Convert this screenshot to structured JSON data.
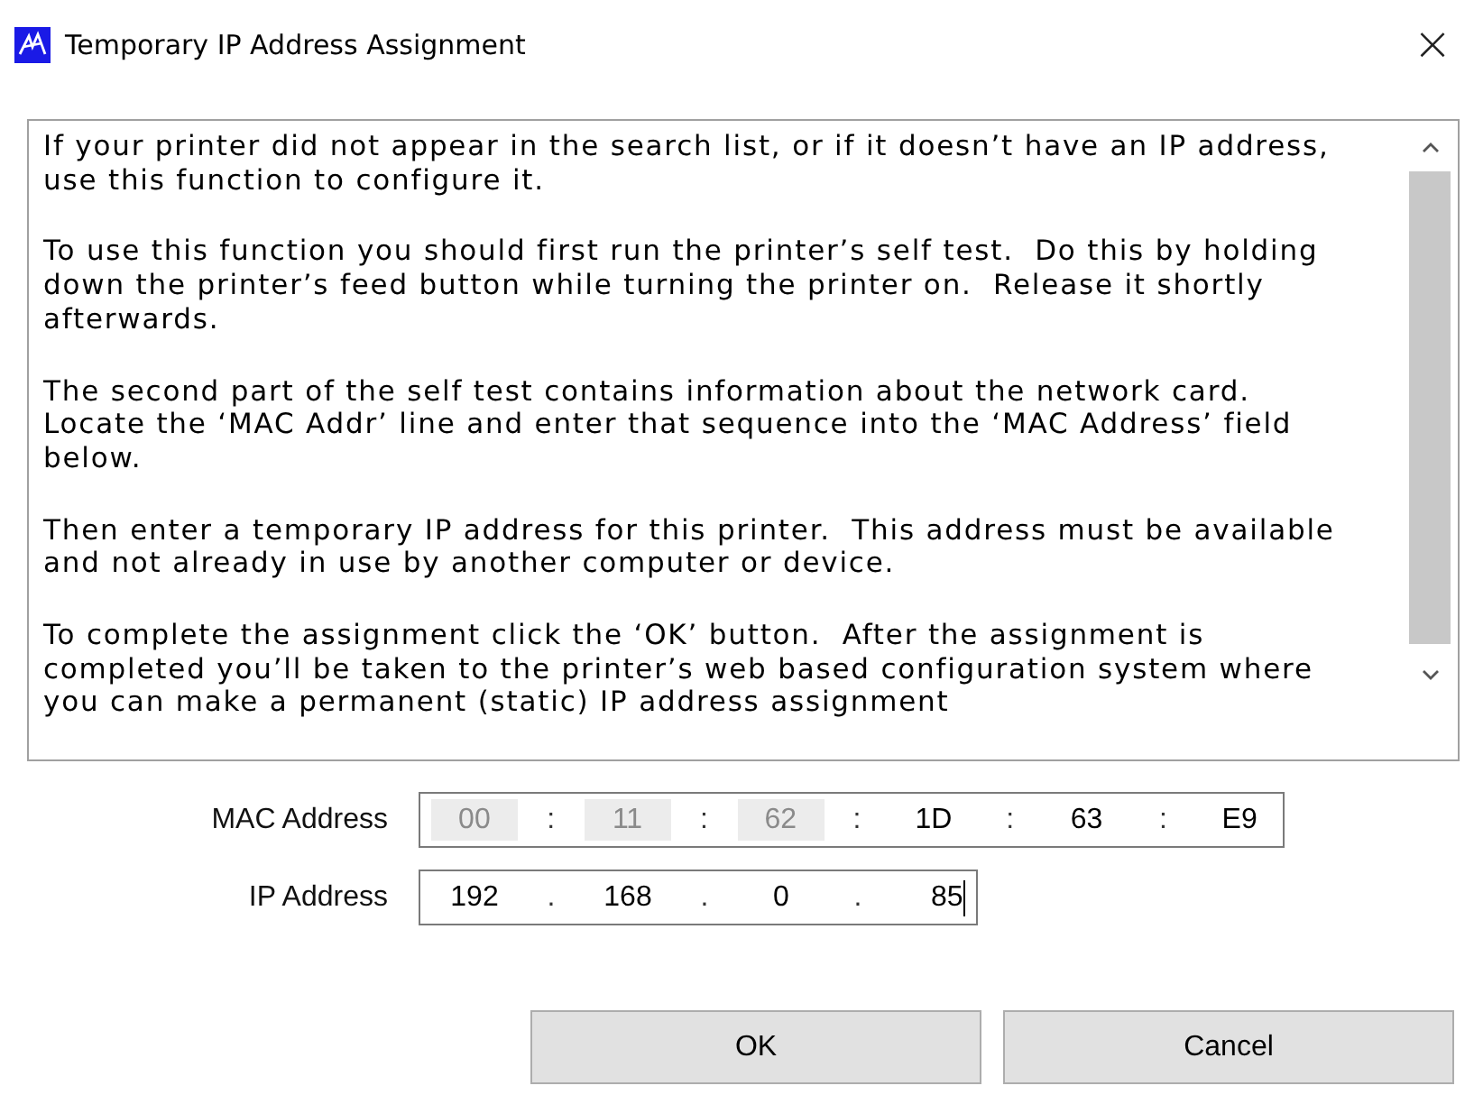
{
  "window": {
    "title": "Temporary IP Address Assignment",
    "close": "×"
  },
  "instructions": [
    [
      "If your printer did not appear in the search list, or if it doesn’t have an IP address,",
      "use this function to configure it."
    ],
    [
      "To use this function you should first run the printer’s self test.  Do this by holding",
      "down the printer’s feed button while turning the printer on.  Release it shortly",
      "afterwards."
    ],
    [
      "The second part of the self test contains information about the network card.",
      "Locate the ‘MAC Addr’ line and enter that sequence into the ‘MAC Address’ field",
      "below."
    ],
    [
      "Then enter a temporary IP address for this printer.  This address must be available",
      "and not already in use by another computer or device."
    ],
    [
      "To complete the assignment click the ‘OK’ button.  After the assignment is",
      "completed you’ll be taken to the printer’s web based configuration system where",
      "you can make a permanent (static) IP address assignment"
    ]
  ],
  "mac_address": {
    "label": "MAC Address",
    "separator": ":",
    "octets": [
      {
        "value": "00",
        "disabled": true
      },
      {
        "value": "11",
        "disabled": true
      },
      {
        "value": "62",
        "disabled": true
      },
      {
        "value": "1D",
        "disabled": false
      },
      {
        "value": "63",
        "disabled": false
      },
      {
        "value": "E9",
        "disabled": false
      }
    ]
  },
  "ip_address": {
    "label": "IP Address",
    "separator": ".",
    "octets": [
      "192",
      "168",
      "0",
      "85"
    ]
  },
  "buttons": [
    "OK",
    "Cancel"
  ]
}
